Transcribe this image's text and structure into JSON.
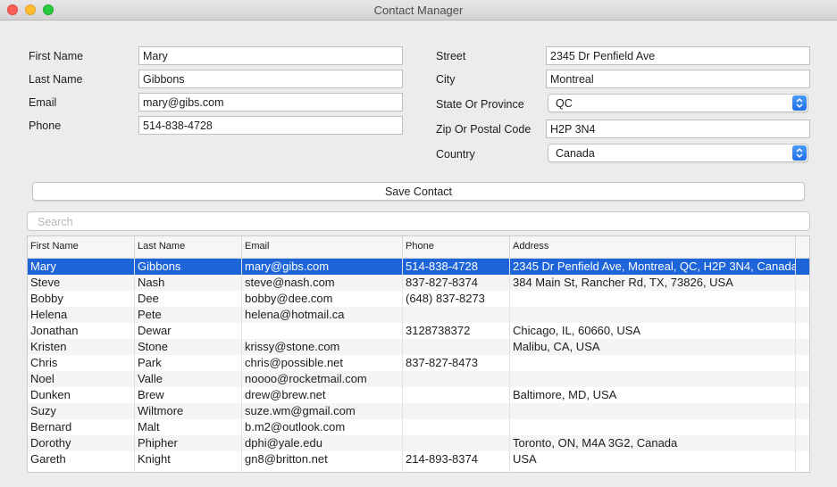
{
  "window": {
    "title": "Contact Manager"
  },
  "form": {
    "first_name": {
      "label": "First Name",
      "value": "Mary"
    },
    "last_name": {
      "label": "Last Name",
      "value": "Gibbons"
    },
    "email": {
      "label": "Email",
      "value": "mary@gibs.com"
    },
    "phone": {
      "label": "Phone",
      "value": "514-838-4728"
    },
    "street": {
      "label": "Street",
      "value": "2345 Dr Penfield Ave"
    },
    "city": {
      "label": "City",
      "value": "Montreal"
    },
    "state": {
      "label": "State Or Province",
      "value": "QC"
    },
    "zip": {
      "label": "Zip Or Postal Code",
      "value": "H2P 3N4"
    },
    "country": {
      "label": "Country",
      "value": "Canada"
    }
  },
  "save_button": {
    "label": "Save Contact"
  },
  "search": {
    "placeholder": "Search"
  },
  "table": {
    "columns": [
      "First Name",
      "Last Name",
      "Email",
      "Phone",
      "Address"
    ],
    "rows": [
      [
        "Mary",
        "Gibbons",
        "mary@gibs.com",
        "514-838-4728",
        "2345 Dr Penfield Ave, Montreal, QC, H2P 3N4, Canada"
      ],
      [
        "Steve",
        "Nash",
        "steve@nash.com",
        "837-827-8374",
        "384 Main St, Rancher Rd, TX, 73826, USA"
      ],
      [
        "Bobby",
        "Dee",
        "bobby@dee.com",
        "(648) 837-8273",
        ""
      ],
      [
        "Helena",
        "Pete",
        "helena@hotmail.ca",
        "",
        ""
      ],
      [
        "Jonathan",
        "Dewar",
        "",
        "3128738372",
        "Chicago, IL, 60660, USA"
      ],
      [
        "Kristen",
        "Stone",
        "krissy@stone.com",
        "",
        "Malibu, CA, USA"
      ],
      [
        "Chris",
        "Park",
        "chris@possible.net",
        "837-827-8473",
        ""
      ],
      [
        "Noel",
        "Valle",
        "noooo@rocketmail.com",
        "",
        ""
      ],
      [
        "Dunken",
        "Brew",
        "drew@brew.net",
        "",
        "Baltimore, MD, USA"
      ],
      [
        "Suzy",
        "Wiltmore",
        "suze.wm@gmail.com",
        "",
        ""
      ],
      [
        "Bernard",
        "Malt",
        "b.m2@outlook.com",
        "",
        ""
      ],
      [
        "Dorothy",
        "Phipher",
        "dphi@yale.edu",
        "",
        "Toronto, ON, M4A 3G2, Canada"
      ],
      [
        "Gareth",
        "Knight",
        "gn8@britton.net",
        "214-893-8374",
        "USA"
      ]
    ],
    "selected_index": 0
  },
  "colors": {
    "selection": "#1d64d8",
    "accent": "#2a7af0"
  }
}
